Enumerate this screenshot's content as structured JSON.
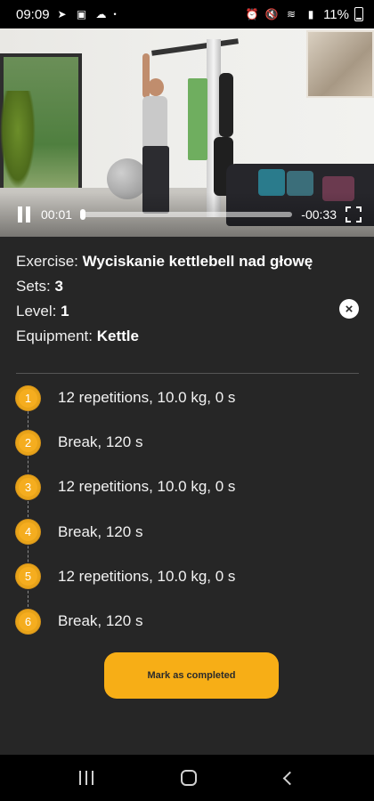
{
  "status_bar": {
    "time": "09:09",
    "left_icons": [
      "telegram-icon",
      "gallery-icon",
      "cloud-icon"
    ],
    "dot": "•",
    "right_icons": [
      "alarm-icon",
      "mute-icon",
      "wifi-icon",
      "signal-icon"
    ],
    "battery": "11%"
  },
  "video": {
    "elapsed": "00:01",
    "remaining": "-00:33",
    "progress_fraction": 0.01,
    "state": "playing"
  },
  "exercise": {
    "exercise_label": "Exercise:",
    "exercise_name": "Wyciskanie kettlebell nad głowę",
    "sets_label": "Sets:",
    "sets_value": "3",
    "level_label": "Level:",
    "level_value": "1",
    "equipment_label": "Equipment:",
    "equipment_value": "Kettle"
  },
  "steps": [
    {
      "num": "1",
      "text": "12 repetitions, 10.0 kg, 0 s"
    },
    {
      "num": "2",
      "text": "Break, 120 s"
    },
    {
      "num": "3",
      "text": "12 repetitions, 10.0 kg, 0 s"
    },
    {
      "num": "4",
      "text": "Break, 120 s"
    },
    {
      "num": "5",
      "text": "12 repetitions, 10.0 kg, 0 s"
    },
    {
      "num": "6",
      "text": "Break, 120 s"
    }
  ],
  "actions": {
    "complete_label": "Mark as completed",
    "close_icon": "×"
  },
  "colors": {
    "accent": "#f7ae16",
    "background": "#262626"
  }
}
